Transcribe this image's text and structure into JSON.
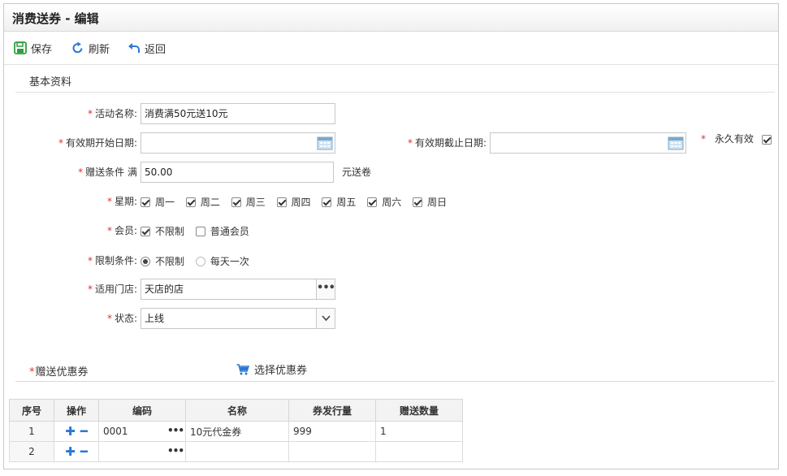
{
  "window": {
    "title": "消费送券 - 编辑"
  },
  "toolbar": {
    "save": "保存",
    "refresh": "刷新",
    "back": "返回"
  },
  "section": {
    "basic": "基本资料"
  },
  "form": {
    "activity_name_label": "活动名称:",
    "activity_name_value": "消费满50元送10元",
    "start_date_label": "有效期开始日期:",
    "start_date_value": "",
    "end_date_label": "有效期截止日期:",
    "end_date_value": "",
    "permanent_label": "永久有效",
    "permanent_checked": true,
    "condition_label": "赠送条件 满",
    "condition_value": "50.00",
    "condition_suffix": "元送卷",
    "weekday_label": "星期:",
    "weekdays": [
      {
        "label": "周一",
        "checked": true
      },
      {
        "label": "周二",
        "checked": true
      },
      {
        "label": "周三",
        "checked": true
      },
      {
        "label": "周四",
        "checked": true
      },
      {
        "label": "周五",
        "checked": true
      },
      {
        "label": "周六",
        "checked": true
      },
      {
        "label": "周日",
        "checked": true
      }
    ],
    "member_label": "会员:",
    "member_options": [
      {
        "label": "不限制",
        "checked": true
      },
      {
        "label": "普通会员",
        "checked": false
      }
    ],
    "limit_label": "限制条件:",
    "limit_options": [
      {
        "label": "不限制",
        "selected": true
      },
      {
        "label": "每天一次",
        "selected": false
      }
    ],
    "store_label": "适用门店:",
    "store_value": "天店的店",
    "status_label": "状态:",
    "status_value": "上线"
  },
  "coupon_section": {
    "label": "赠送优惠券",
    "pick": "选择优惠券"
  },
  "grid": {
    "columns": [
      "序号",
      "操作",
      "编码",
      "名称",
      "券发行量",
      "赠送数量"
    ],
    "rows": [
      {
        "idx": "1",
        "code": "0001",
        "name": "10元代金券",
        "issue": "999",
        "qty": "1"
      },
      {
        "idx": "2",
        "code": "",
        "name": "",
        "issue": "",
        "qty": ""
      }
    ]
  },
  "colors": {
    "required": "#e03030",
    "accent": "#2a78d4",
    "save_icon": "#2e9e3e"
  }
}
